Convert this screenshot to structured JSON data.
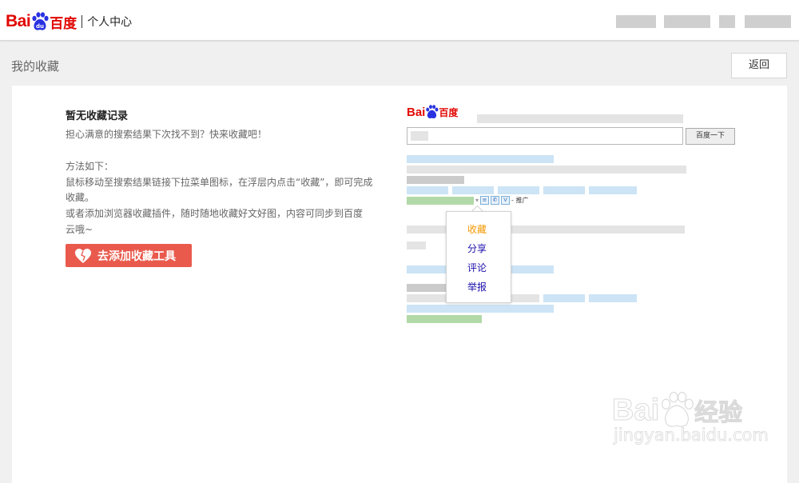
{
  "header": {
    "logo_bai": "Bai",
    "logo_cn": "百度",
    "section_title": "个人中心"
  },
  "page": {
    "title": "我的收藏",
    "back_label": "返回"
  },
  "empty_state": {
    "title": "暂无收藏记录",
    "subtitle": "担心满意的搜索结果下次找不到？快来收藏吧！",
    "method_heading": "方法如下：",
    "method_line1": "鼠标移动至搜索结果链接下拉菜单图标，在浮层内点击“收藏”，即可完成",
    "method_line2": "收藏。",
    "method_line3": "或者添加浏览器收藏插件，随时随地收藏好文好图，内容可同步到百度",
    "method_line4": "云哦~",
    "add_tool_label": "去添加收藏工具"
  },
  "illustration": {
    "logo_bai": "Bai",
    "logo_cn": "百度",
    "search_button": "百度一下",
    "promo_label": "- 推广",
    "menu": [
      {
        "label": "收藏",
        "color": "#f39800"
      },
      {
        "label": "分享",
        "color": "#1a0dab"
      },
      {
        "label": "评论",
        "color": "#1a0dab"
      },
      {
        "label": "举报",
        "color": "#1a0dab"
      }
    ]
  },
  "watermark": {
    "brand": "Bai",
    "cn": "经验",
    "url": "jingyan.baidu.com"
  },
  "colors": {
    "brand_red": "#e10601",
    "button_red": "#e95a4d",
    "menu_active": "#f39800",
    "link_blue": "#1a0dab"
  }
}
